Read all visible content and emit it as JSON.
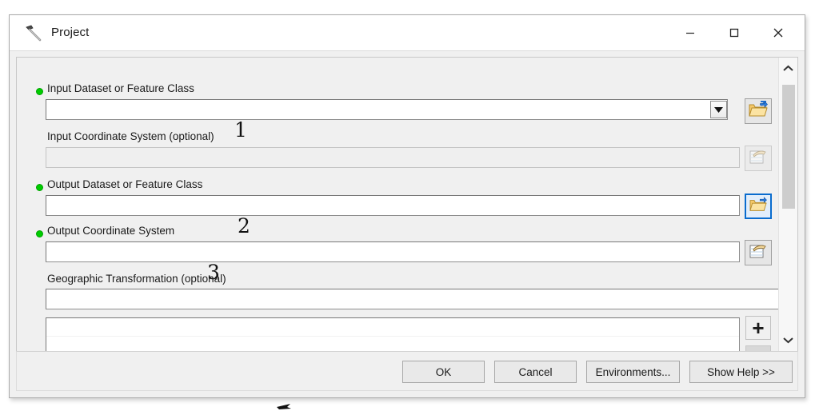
{
  "window": {
    "title": "Project",
    "icon": "hammer-tool-icon",
    "controls": {
      "minimize": "minimize-icon",
      "maximize": "maximize-icon",
      "close": "close-icon"
    }
  },
  "form": {
    "params": [
      {
        "label": "Input Dataset or Feature Class",
        "required": true,
        "value": "",
        "control": "combobox",
        "side_button": "browse-folder-icon",
        "side_button_state": "enabled",
        "annotation": "1"
      },
      {
        "label": "Input Coordinate System (optional)",
        "required": false,
        "value": "",
        "control": "textbox",
        "side_button": "coordinate-system-icon",
        "side_button_state": "disabled",
        "annotation": ""
      },
      {
        "label": "Output Dataset or Feature Class",
        "required": true,
        "value": "",
        "control": "textbox",
        "side_button": "browse-folder-icon",
        "side_button_state": "focused",
        "annotation": "2"
      },
      {
        "label": "Output Coordinate System",
        "required": true,
        "value": "",
        "control": "textbox",
        "side_button": "coordinate-system-icon",
        "side_button_state": "enabled",
        "annotation": "3"
      },
      {
        "label": "Geographic Transformation (optional)",
        "required": false,
        "value": "",
        "control": "textbox",
        "side_button": "",
        "side_button_state": "",
        "annotation": ""
      }
    ],
    "transformation_list": {
      "rows": [
        "",
        "",
        ""
      ],
      "add_label": "+",
      "remove_label": "×"
    }
  },
  "scrollbar": {
    "up_arrow": "chevron-up-icon",
    "down_arrow": "chevron-down-icon"
  },
  "footer": {
    "ok": "OK",
    "cancel": "Cancel",
    "environments": "Environments...",
    "show_help": "Show Help >>"
  },
  "colors": {
    "required_dot": "#00cc00",
    "focus_border": "#0a6cce",
    "window_bg": "#f0f0f0",
    "titlebar_bg": "#ffffff",
    "field_bg": "#ffffff"
  }
}
